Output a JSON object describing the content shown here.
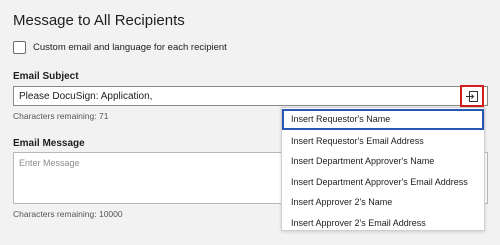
{
  "section": {
    "title": "Message to All Recipients"
  },
  "custom_checkbox": {
    "label": "Custom email and language for each recipient",
    "checked": false
  },
  "subject": {
    "label": "Email Subject",
    "value": "Please DocuSign: Application,",
    "chars_remaining": "Characters remaining: 71"
  },
  "merge_button": {
    "icon": "insert-field-icon",
    "highlight_color": "#d41d1d"
  },
  "dropdown": {
    "items": [
      {
        "label": "Insert Requestor's Name",
        "active": true
      },
      {
        "label": "Insert Requestor's Email Address"
      },
      {
        "label": "Insert Department Approver's Name"
      },
      {
        "label": "Insert Department Approver's Email Address"
      },
      {
        "label": "Insert Approver 2's Name"
      },
      {
        "label": "Insert Approver 2's Email Address"
      }
    ],
    "active_border_color": "#2757b3"
  },
  "message": {
    "label": "Email Message",
    "placeholder": "Enter Message",
    "chars_remaining": "Characters remaining: 10000"
  }
}
